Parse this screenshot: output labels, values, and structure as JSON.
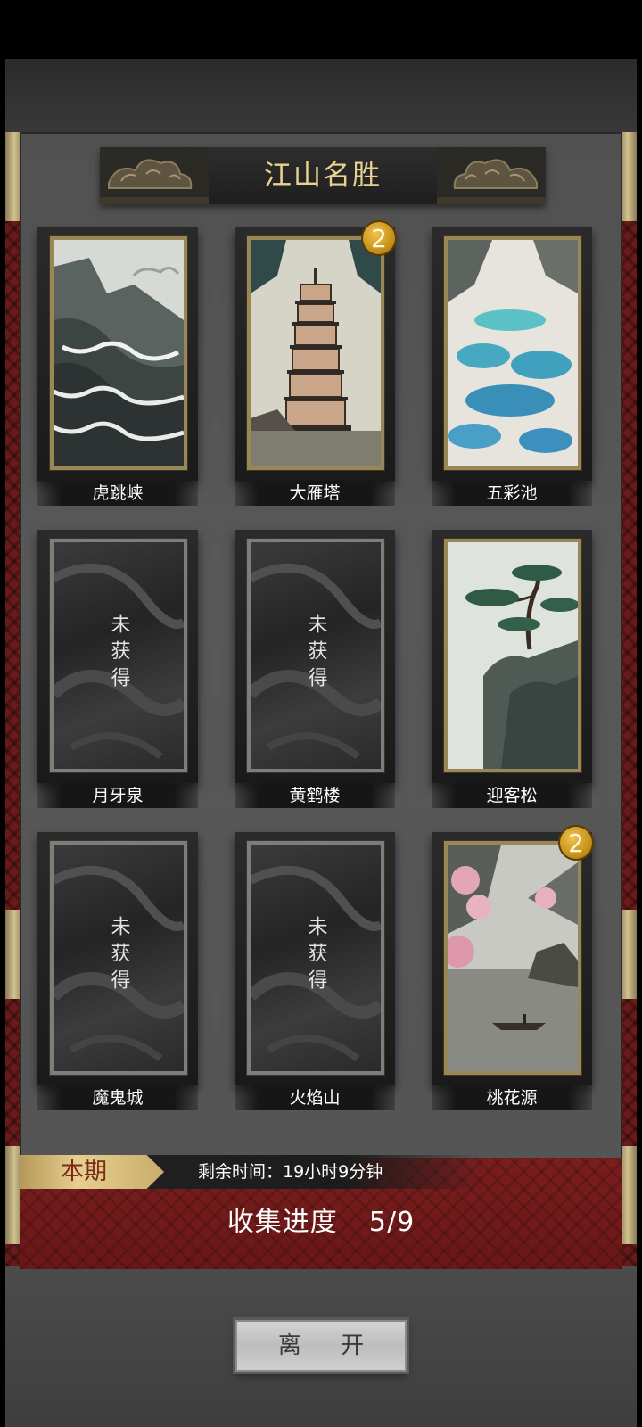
{
  "title": "江山名胜",
  "cards": [
    {
      "name": "虎跳峡",
      "locked": false,
      "badge": ""
    },
    {
      "name": "大雁塔",
      "locked": false,
      "badge": "2"
    },
    {
      "name": "五彩池",
      "locked": false,
      "badge": ""
    },
    {
      "name": "月牙泉",
      "locked": true,
      "badge": "",
      "locked_text": "未获得"
    },
    {
      "name": "黄鹤楼",
      "locked": true,
      "badge": "",
      "locked_text": "未获得"
    },
    {
      "name": "迎客松",
      "locked": false,
      "badge": ""
    },
    {
      "name": "魔鬼城",
      "locked": true,
      "badge": "",
      "locked_text": "未获得"
    },
    {
      "name": "火焰山",
      "locked": true,
      "badge": "",
      "locked_text": "未获得"
    },
    {
      "name": "桃花源",
      "locked": false,
      "badge": "2"
    }
  ],
  "period": {
    "tag": "本期",
    "remaining_time": "剩余时间：19小时9分钟"
  },
  "progress": {
    "label": "收集进度",
    "value": "5/9"
  },
  "leave_button": "离 开",
  "colors": {
    "gold": "#ead291",
    "red_banner": "#7a1e1e",
    "badge": "#d49b1e"
  }
}
